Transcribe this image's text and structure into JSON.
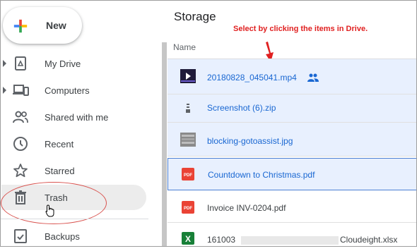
{
  "new_button": {
    "label": "New"
  },
  "sidebar": {
    "items": [
      {
        "label": "My Drive",
        "icon": "my-drive-icon",
        "has_caret": true
      },
      {
        "label": "Computers",
        "icon": "computers-icon",
        "has_caret": true
      },
      {
        "label": "Shared with me",
        "icon": "shared-icon",
        "has_caret": false
      },
      {
        "label": "Recent",
        "icon": "clock-icon",
        "has_caret": false
      },
      {
        "label": "Starred",
        "icon": "star-icon",
        "has_caret": false
      },
      {
        "label": "Trash",
        "icon": "trash-icon",
        "has_caret": false
      },
      {
        "label": "Backups",
        "icon": "backups-icon",
        "has_caret": false
      }
    ]
  },
  "main": {
    "title": "Storage",
    "annotation": "Select by clicking the items in Drive.",
    "column_name": "Name",
    "files": [
      {
        "name": "20180828_045041.mp4",
        "type": "video",
        "selected": true,
        "shared": true
      },
      {
        "name": "Screenshot (6).zip",
        "type": "zip",
        "selected": true
      },
      {
        "name": "blocking-gotoassist.jpg",
        "type": "image",
        "selected": true
      },
      {
        "name": "Countdown to Christmas.pdf",
        "type": "pdf",
        "selected": true,
        "focused": true
      },
      {
        "name": "Invoice INV-0204.pdf",
        "type": "pdf",
        "selected": false
      },
      {
        "name": "161003",
        "name_suffix": "Cloudeight.xlsx",
        "type": "xlsx",
        "selected": false
      }
    ]
  },
  "colors": {
    "selection": "#e8f0fe",
    "link": "#1967d2",
    "annotation": "#e02020",
    "pdf": "#ea4335",
    "xlsx": "#188038"
  }
}
